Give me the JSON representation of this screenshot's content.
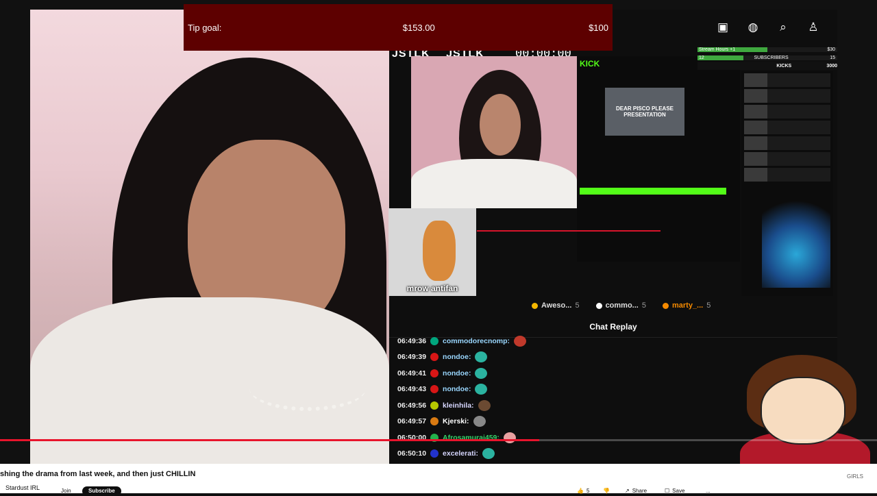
{
  "tip_goal": {
    "label": "Tip goal:",
    "current": "$153.00",
    "target": "$100"
  },
  "stream": {
    "logos": [
      "JSTLK",
      "JSTLK"
    ],
    "timer": "00:00:00",
    "kick_logo": "KICK",
    "thumb_text": "DEAR PISCO PLEASE PRESENTATION",
    "cat_label": "mrow antifan"
  },
  "overlay": {
    "rows": [
      {
        "a": "Stream Hours +1",
        "b": "$30"
      },
      {
        "a": "12",
        "b": "15"
      }
    ],
    "subscribers": "SUBSCRIBERS",
    "kicks": "KICKS",
    "kicks_value": "3000"
  },
  "leaders": [
    {
      "name": "Aweso...",
      "count": "5",
      "color": "#f5b700"
    },
    {
      "name": "commo...",
      "count": "5",
      "color": "#ffffff"
    },
    {
      "name": "marty_...",
      "count": "5",
      "color": "#f58a00"
    }
  ],
  "chat_title": "Chat Replay",
  "chat": [
    {
      "ts": "06:49:36",
      "user": "commodorecnomp:",
      "color": "#9ad7ff",
      "badge": "#00a67e"
    },
    {
      "ts": "06:49:39",
      "user": "nondoe:",
      "color": "#9ad7ff",
      "badge": "#d81616"
    },
    {
      "ts": "06:49:41",
      "user": "nondoe:",
      "color": "#9ad7ff",
      "badge": "#d81616"
    },
    {
      "ts": "06:49:43",
      "user": "nondoe:",
      "color": "#9ad7ff",
      "badge": "#d81616"
    },
    {
      "ts": "06:49:56",
      "user": "kleinhila:",
      "color": "#d7d7ff",
      "badge": "#b6c800"
    },
    {
      "ts": "06:49:57",
      "user": "Kjerski:",
      "color": "#ffffff",
      "badge": "#d97a12"
    },
    {
      "ts": "06:50:00",
      "user": "Afrosamurai459:",
      "color": "#34d46a",
      "badge": "#22b14c"
    },
    {
      "ts": "06:50:10",
      "user": "excelerati:",
      "color": "#d7d7ff",
      "badge": "#2233cc"
    }
  ],
  "video": {
    "title": "shing the drama from last week, and then just CHILLIN",
    "channel": "Stardust IRL",
    "join": "Join",
    "subscribe": "Subscribe",
    "likes": "5",
    "share": "Share",
    "save": "Save",
    "more": "...",
    "partial": "GIRLS",
    "progress": 0.615
  },
  "icons": [
    "create-icon",
    "globe-icon",
    "search-icon",
    "account-icon"
  ]
}
